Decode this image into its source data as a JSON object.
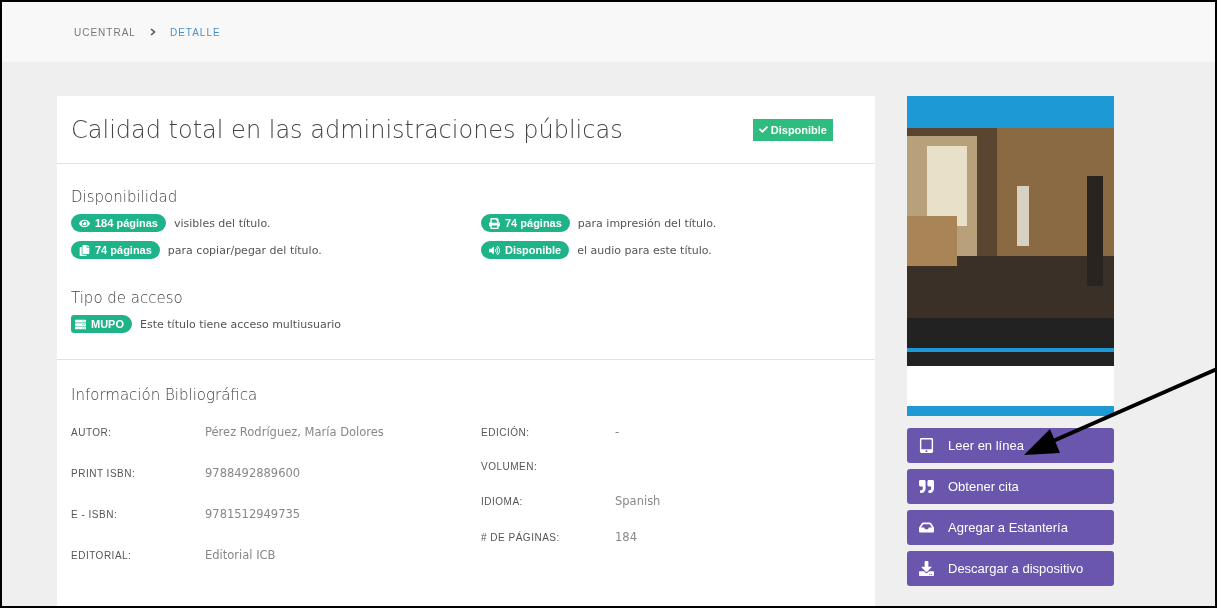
{
  "breadcrumb": [
    {
      "label": "UCENTRAL",
      "selected": false
    },
    {
      "label": "DETALLE",
      "selected": true
    }
  ],
  "title": "Calidad total en las administraciones públicas",
  "status_badge": {
    "label": "Disponible",
    "kind": "available"
  },
  "availability": {
    "heading": "Disponibilidad",
    "items": [
      {
        "kind": "eye",
        "badge": "184 páginas",
        "text": "visibles del título."
      },
      {
        "kind": "print",
        "badge": "74 páginas",
        "text": "para impresión del título."
      },
      {
        "kind": "copy",
        "badge": "74 páginas",
        "text": "para copiar/pegar del título."
      },
      {
        "kind": "audio",
        "badge": "Disponible",
        "text": "el audio para este título."
      }
    ]
  },
  "access": {
    "heading": "Tipo de acceso",
    "badge": "MUPO",
    "text": "Este título tiene acceso multiusuario"
  },
  "bibliography": {
    "heading": "Información Bibliográfica",
    "left": [
      {
        "label": "AUTOR:",
        "value": "Pérez Rodríguez, María Dolores"
      },
      {
        "label": "PRINT ISBN:",
        "value": "9788492889600"
      },
      {
        "label": "E - ISBN:",
        "value": "9781512949735"
      },
      {
        "label": "EDITORIAL:",
        "value": "Editorial ICB"
      }
    ],
    "right": [
      {
        "label": "EDICIÓN:",
        "value": "-"
      },
      {
        "label": "VOLUMEN:"
      },
      {
        "label": "IDIOMA:",
        "value": "Spanish"
      },
      {
        "label": "# DE PÁGINAS:",
        "value": "184"
      }
    ]
  },
  "actions": [
    {
      "kind": "read",
      "label": "Leer en línea"
    },
    {
      "kind": "cite",
      "label": "Obtener cita"
    },
    {
      "kind": "shelf",
      "label": "Agregar a Estantería"
    },
    {
      "kind": "download",
      "label": "Descargar a dispositivo"
    }
  ],
  "annotation": {
    "kind": "arrow"
  }
}
